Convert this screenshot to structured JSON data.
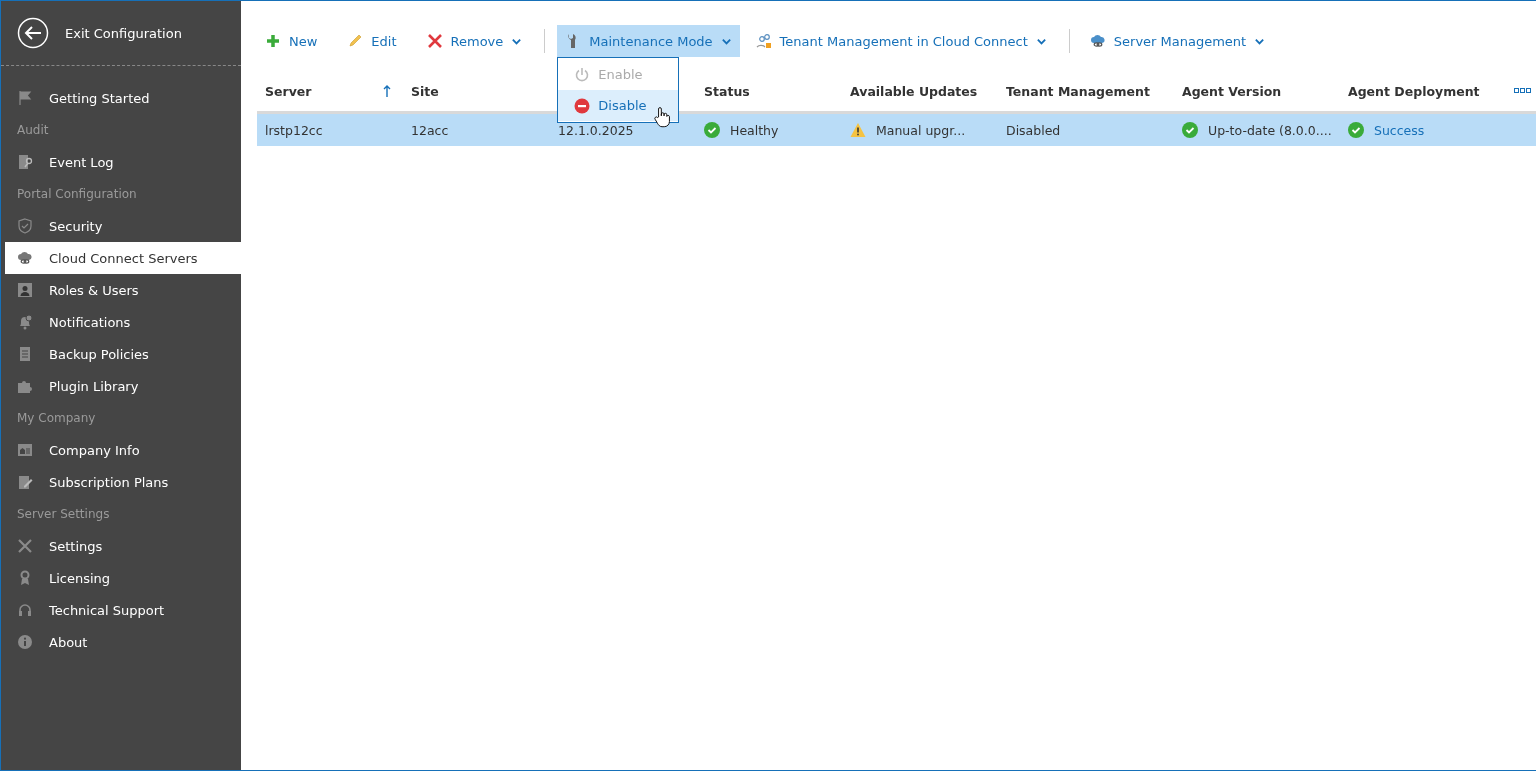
{
  "sidebar": {
    "exit": {
      "label": "Exit Configuration"
    },
    "items": [
      {
        "kind": "item",
        "label": "Getting Started",
        "selected": false
      },
      {
        "kind": "section",
        "label": "Audit"
      },
      {
        "kind": "item",
        "label": "Event Log",
        "selected": false
      },
      {
        "kind": "section",
        "label": "Portal Configuration"
      },
      {
        "kind": "item",
        "label": "Security",
        "selected": false
      },
      {
        "kind": "item",
        "label": "Cloud Connect Servers",
        "selected": true
      },
      {
        "kind": "item",
        "label": "Roles & Users",
        "selected": false
      },
      {
        "kind": "item",
        "label": "Notifications",
        "selected": false
      },
      {
        "kind": "item",
        "label": "Backup Policies",
        "selected": false
      },
      {
        "kind": "item",
        "label": "Plugin Library",
        "selected": false
      },
      {
        "kind": "section",
        "label": "My Company"
      },
      {
        "kind": "item",
        "label": "Company Info",
        "selected": false
      },
      {
        "kind": "item",
        "label": "Subscription Plans",
        "selected": false
      },
      {
        "kind": "section",
        "label": "Server Settings"
      },
      {
        "kind": "item",
        "label": "Settings",
        "selected": false
      },
      {
        "kind": "item",
        "label": "Licensing",
        "selected": false
      },
      {
        "kind": "item",
        "label": "Technical Support",
        "selected": false
      },
      {
        "kind": "item",
        "label": "About",
        "selected": false
      }
    ]
  },
  "toolbar": [
    {
      "kind": "button",
      "label": "New",
      "has_menu": false,
      "open": false
    },
    {
      "kind": "button",
      "label": "Edit",
      "has_menu": false,
      "open": false
    },
    {
      "kind": "button",
      "label": "Remove",
      "has_menu": true,
      "open": false
    },
    {
      "kind": "separator"
    },
    {
      "kind": "button",
      "label": "Maintenance Mode",
      "has_menu": true,
      "open": true,
      "menu": [
        {
          "label": "Enable",
          "disabled": true,
          "selected": false
        },
        {
          "label": "Disable",
          "disabled": false,
          "selected": true
        }
      ]
    },
    {
      "kind": "button",
      "label": "Tenant Management in Cloud Connect",
      "has_menu": true,
      "open": false
    },
    {
      "kind": "separator"
    },
    {
      "kind": "button",
      "label": "Server Management",
      "has_menu": true,
      "open": false
    }
  ],
  "table": {
    "columns": [
      {
        "label": "Server",
        "sorted": true
      },
      {
        "label": "Site",
        "sorted": false
      },
      "",
      {
        "label": "Status",
        "sorted": false
      },
      {
        "label": "Available Updates",
        "sorted": false
      },
      {
        "label": "Tenant Management",
        "sorted": false
      },
      {
        "label": "Agent Version",
        "sorted": false
      },
      {
        "label": "Agent Deployment",
        "sorted": false
      }
    ],
    "rows": [
      {
        "selected": true,
        "cells": [
          {
            "kind": "text",
            "text": "lrstp12cc"
          },
          {
            "kind": "text",
            "text": "12acc"
          },
          {
            "kind": "text",
            "text": "12.1.0.2025"
          },
          {
            "kind": "ok",
            "text": "Healthy"
          },
          {
            "kind": "warning",
            "text": "Manual upgr..."
          },
          {
            "kind": "text",
            "text": "Disabled"
          },
          {
            "kind": "ok",
            "text": "Up-to-date (8.0.0...."
          },
          {
            "kind": "ok-link",
            "text": "Success"
          }
        ]
      }
    ]
  }
}
